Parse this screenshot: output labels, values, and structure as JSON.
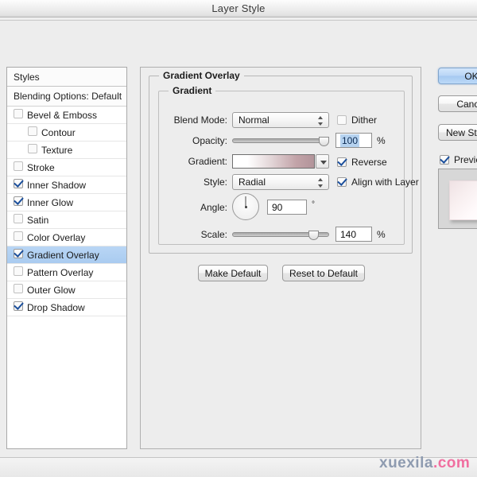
{
  "window": {
    "title": "Layer Style"
  },
  "sidebar": {
    "header": "Styles",
    "blending_options": "Blending Options: Default",
    "items": [
      {
        "label": "Bevel & Emboss",
        "checked": false,
        "indent": false,
        "selected": false
      },
      {
        "label": "Contour",
        "checked": false,
        "indent": true,
        "selected": false
      },
      {
        "label": "Texture",
        "checked": false,
        "indent": true,
        "selected": false
      },
      {
        "label": "Stroke",
        "checked": false,
        "indent": false,
        "selected": false
      },
      {
        "label": "Inner Shadow",
        "checked": true,
        "indent": false,
        "selected": false
      },
      {
        "label": "Inner Glow",
        "checked": true,
        "indent": false,
        "selected": false
      },
      {
        "label": "Satin",
        "checked": false,
        "indent": false,
        "selected": false
      },
      {
        "label": "Color Overlay",
        "checked": false,
        "indent": false,
        "selected": false
      },
      {
        "label": "Gradient Overlay",
        "checked": true,
        "indent": false,
        "selected": true
      },
      {
        "label": "Pattern Overlay",
        "checked": false,
        "indent": false,
        "selected": false
      },
      {
        "label": "Outer Glow",
        "checked": false,
        "indent": false,
        "selected": false
      },
      {
        "label": "Drop Shadow",
        "checked": true,
        "indent": false,
        "selected": false
      }
    ]
  },
  "panel": {
    "group_title": "Gradient Overlay",
    "subgroup_title": "Gradient",
    "blend_mode": {
      "label": "Blend Mode:",
      "value": "Normal"
    },
    "dither": {
      "label": "Dither",
      "checked": false
    },
    "opacity": {
      "label": "Opacity:",
      "value": "100",
      "unit": "%",
      "slider_percent": 100
    },
    "gradient": {
      "label": "Gradient:",
      "swatch_start": "#ffffff",
      "swatch_end": "#b2949a"
    },
    "reverse": {
      "label": "Reverse",
      "checked": true
    },
    "style": {
      "label": "Style:",
      "value": "Radial"
    },
    "align_with_layer": {
      "label": "Align with Layer",
      "checked": true
    },
    "angle": {
      "label": "Angle:",
      "value": "90",
      "unit": "°"
    },
    "scale": {
      "label": "Scale:",
      "value": "140",
      "unit": "%",
      "slider_percent": 88
    },
    "make_default": "Make Default",
    "reset_to_default": "Reset to Default"
  },
  "actions": {
    "ok": "OK",
    "cancel": "Cancel",
    "new_style": "New Style...",
    "preview": {
      "label": "Preview",
      "checked": true
    }
  },
  "watermark": {
    "part1": "xuexila",
    "part2": ".com"
  }
}
